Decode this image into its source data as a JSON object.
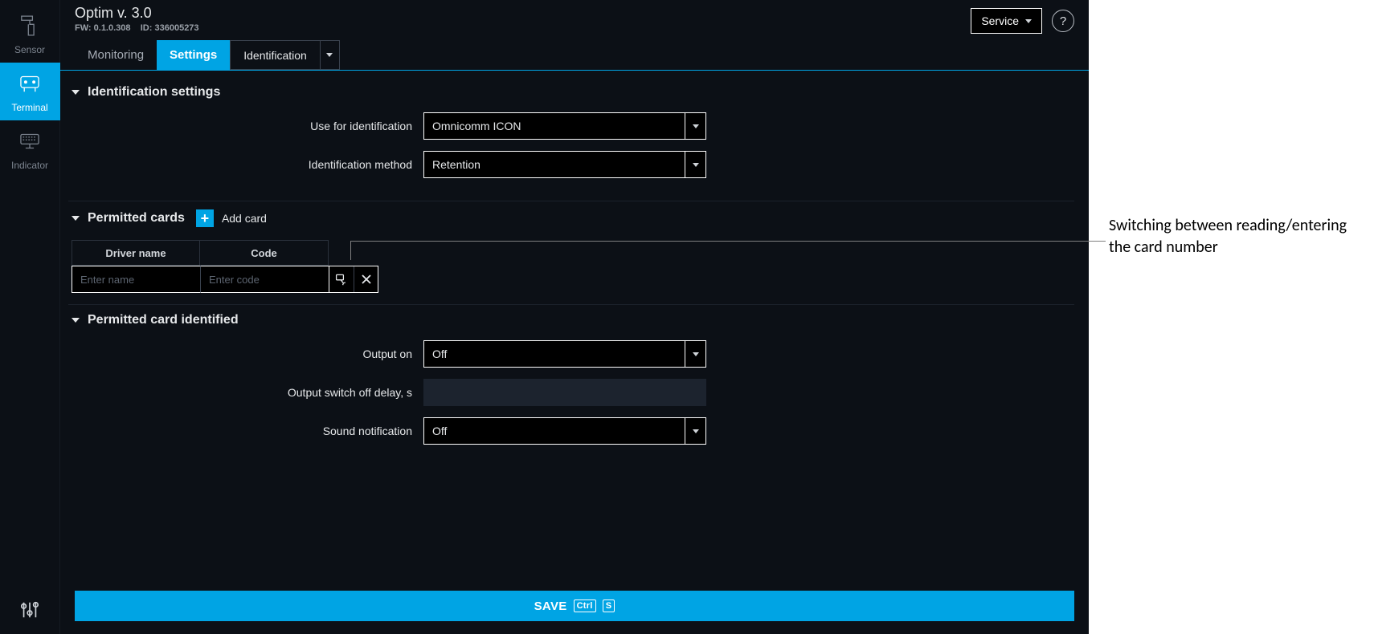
{
  "sidebar": {
    "items": [
      {
        "label": "Sensor"
      },
      {
        "label": "Terminal"
      },
      {
        "label": "Indicator"
      }
    ]
  },
  "header": {
    "title": "Optim v. 3.0",
    "fw_label": "FW:",
    "fw_value": "0.1.0.308",
    "id_label": "ID:",
    "id_value": "336005273",
    "service_label": "Service",
    "help_symbol": "?"
  },
  "tabs": {
    "monitoring": "Monitoring",
    "settings": "Settings",
    "sub_identification": "Identification"
  },
  "sections": {
    "ident": {
      "title": "Identification settings",
      "use_label": "Use for identification",
      "use_value": "Omnicomm ICON",
      "method_label": "Identification method",
      "method_value": "Retention"
    },
    "cards": {
      "title": "Permitted cards",
      "add_label": "Add card",
      "col_name": "Driver name",
      "col_code": "Code",
      "ph_name": "Enter name",
      "ph_code": "Enter code"
    },
    "identified": {
      "title": "Permitted card identified",
      "output_on_label": "Output on",
      "output_on_value": "Off",
      "delay_label": "Output switch off delay, s",
      "sound_label": "Sound notification",
      "sound_value": "Off"
    }
  },
  "save": {
    "label": "SAVE",
    "kbd1": "Ctrl",
    "kbd2": "S"
  },
  "annotation": {
    "text": "Switching between reading/entering the card number"
  }
}
